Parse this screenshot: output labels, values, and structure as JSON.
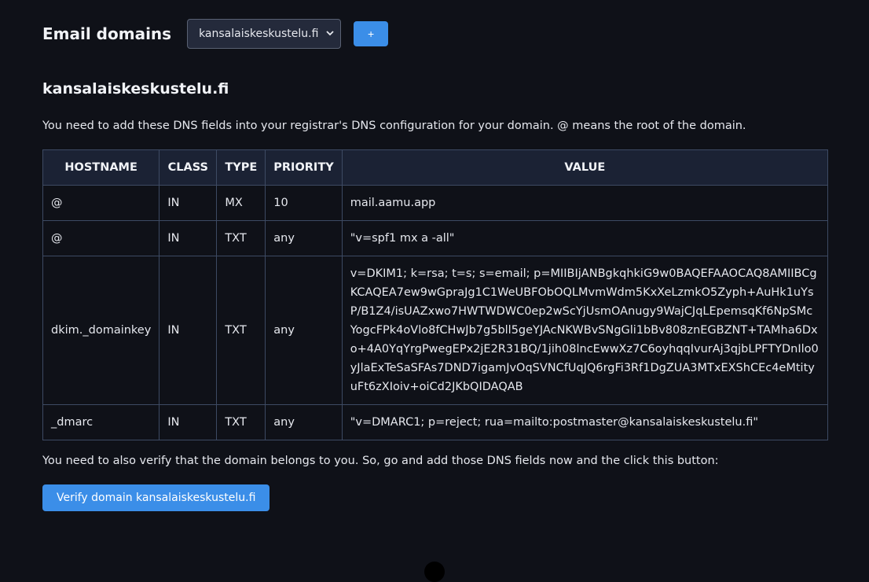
{
  "header": {
    "title": "Email domains",
    "selected_domain": "kansalaiskeskustelu.fi",
    "add_label": "+"
  },
  "domain": {
    "heading": "kansalaiskeskustelu.fi",
    "instructions": "You need to add these DNS fields into your registrar's DNS configuration for your domain. @ means the root of the domain."
  },
  "table": {
    "columns": [
      "HOSTNAME",
      "CLASS",
      "TYPE",
      "PRIORITY",
      "VALUE"
    ],
    "rows": [
      {
        "hostname": "@",
        "class": "IN",
        "type": "MX",
        "priority": "10",
        "value": "mail.aamu.app"
      },
      {
        "hostname": "@",
        "class": "IN",
        "type": "TXT",
        "priority": "any",
        "value": "\"v=spf1 mx a -all\""
      },
      {
        "hostname": "dkim._domainkey",
        "class": "IN",
        "type": "TXT",
        "priority": "any",
        "value": "v=DKIM1; k=rsa; t=s; s=email; p=MIIBIjANBgkqhkiG9w0BAQEFAAOCAQ8AMIIBCgKCAQEA7ew9wGpraJg1C1WeUBFObOQLMvmWdm5KxXeLzmkO5Zyph+AuHk1uYsP/B1Z4/isUAZxwo7HWTWDWC0ep2wScYjUsmOAnugy9WajCJqLEpemsqKf6NpSMcYogcFPk4oVlo8fCHwJb7g5bll5geYJAcNKWBvSNgGli1bBv808znEGBZNT+TAMha6Dxo+4A0YqYrgPwegEPx2jE2R31BQ/1jih08lncEwwXz7C6oyhqqIvurAj3qjbLPFTYDnIlo0yJlaExTeSaSFAs7DND7igamJvOqSVNCfUqJQ6rgFi3Rf1DgZUA3MTxEXShCEc4eMtityuFt6zXIoiv+oiCd2JKbQIDAQAB"
      },
      {
        "hostname": "_dmarc",
        "class": "IN",
        "type": "TXT",
        "priority": "any",
        "value": "\"v=DMARC1; p=reject; rua=mailto:postmaster@kansalaiskeskustelu.fi\""
      }
    ]
  },
  "footer": {
    "text": "You need to also verify that the domain belongs to you. So, go and add those DNS fields now and the click this button:",
    "verify_label": "Verify domain kansalaiskeskustelu.fi"
  },
  "icons": {
    "select_chevron": "chevron-down-icon"
  },
  "colors": {
    "background": "#0f1118",
    "accent": "#3b8ee8",
    "table_border": "#3d4a63",
    "header_bg": "#1b2234",
    "select_bg": "#242a3b"
  }
}
